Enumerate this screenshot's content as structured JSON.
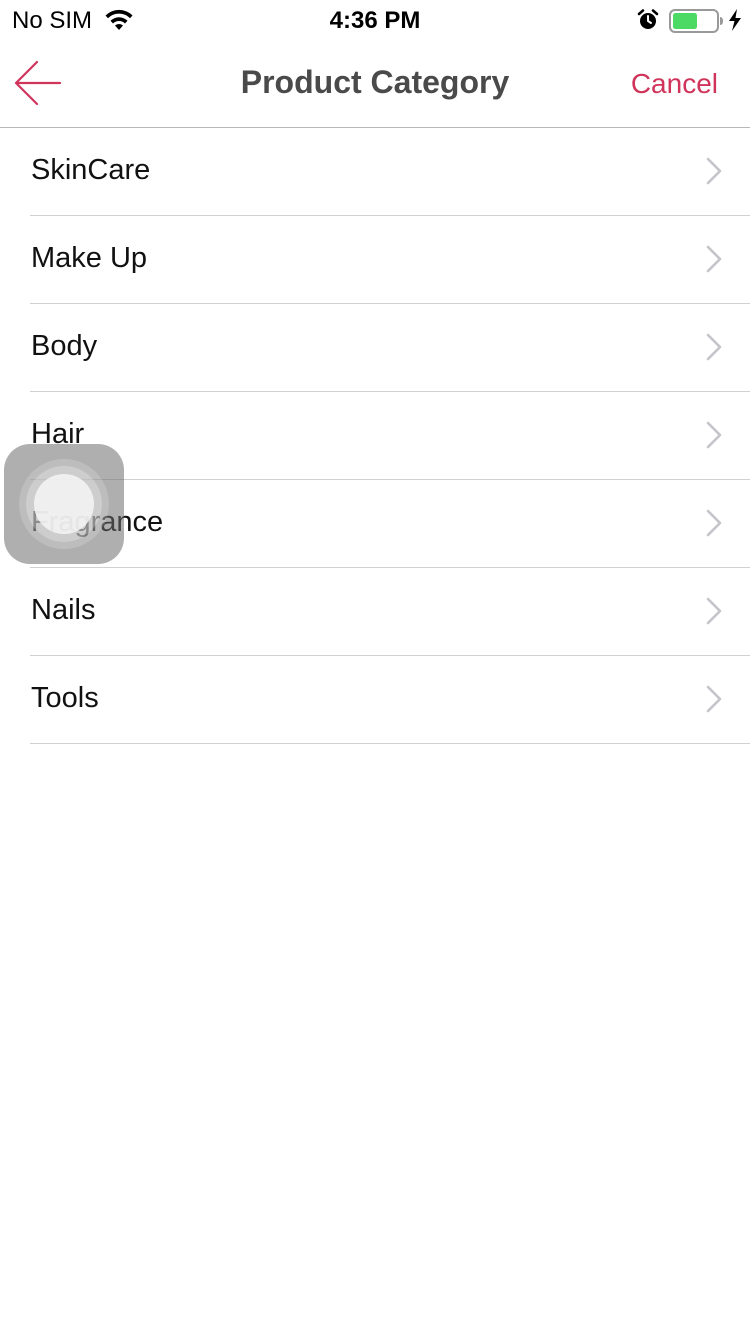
{
  "status_bar": {
    "carrier": "No SIM",
    "time": "4:36 PM",
    "battery_color": "#4cd964",
    "icons": [
      "wifi-icon",
      "alarm-icon",
      "battery-icon",
      "charging-bolt-icon"
    ]
  },
  "nav": {
    "title": "Product Category",
    "cancel_label": "Cancel",
    "back_icon": "arrow-left-icon",
    "accent_color": "#d0345b"
  },
  "categories": [
    {
      "label": "SkinCare"
    },
    {
      "label": "Make Up"
    },
    {
      "label": "Body"
    },
    {
      "label": "Hair"
    },
    {
      "label": "Fragrance"
    },
    {
      "label": "Nails"
    },
    {
      "label": "Tools"
    }
  ],
  "overlay": {
    "icon": "assistive-touch-icon"
  }
}
